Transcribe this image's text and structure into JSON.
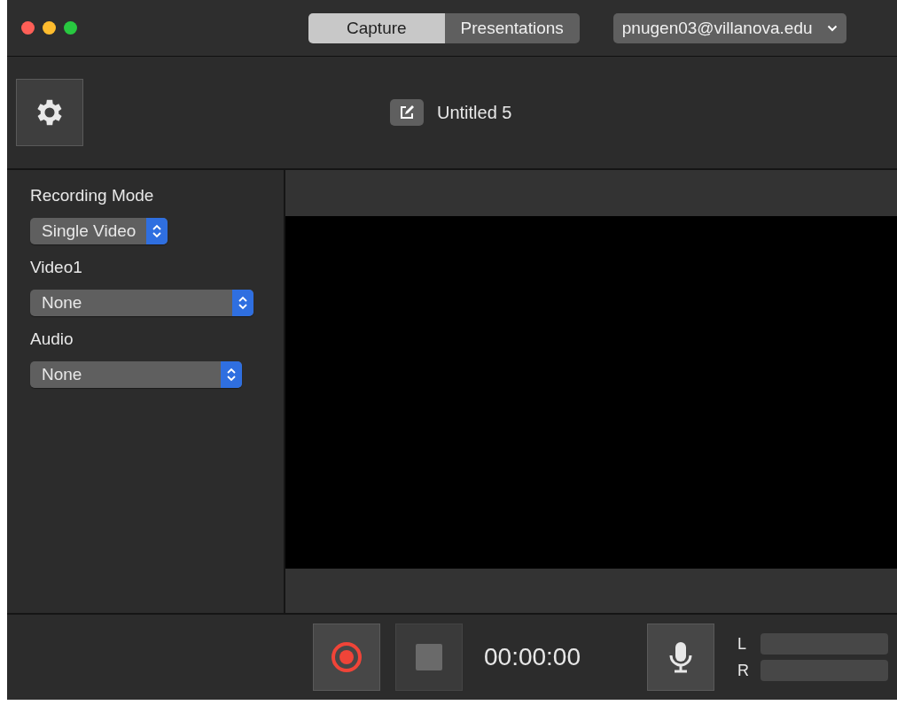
{
  "window": {
    "tabs": [
      {
        "label": "Capture",
        "selected": true
      },
      {
        "label": "Presentations",
        "selected": false
      }
    ],
    "account": {
      "value": "pnugen03@villanova.edu"
    }
  },
  "toolbar": {
    "title": "Untitled 5"
  },
  "sidebar": {
    "fields": [
      {
        "label": "Recording Mode",
        "value": "Single Video"
      },
      {
        "label": "Video1",
        "value": "None"
      },
      {
        "label": "Audio",
        "value": "None"
      }
    ]
  },
  "controls": {
    "record": {
      "disabled": false
    },
    "stop": {
      "disabled": true
    },
    "timer": "00:00:00",
    "meters": [
      {
        "label": "L",
        "level": 0
      },
      {
        "label": "R",
        "level": 0
      }
    ]
  }
}
